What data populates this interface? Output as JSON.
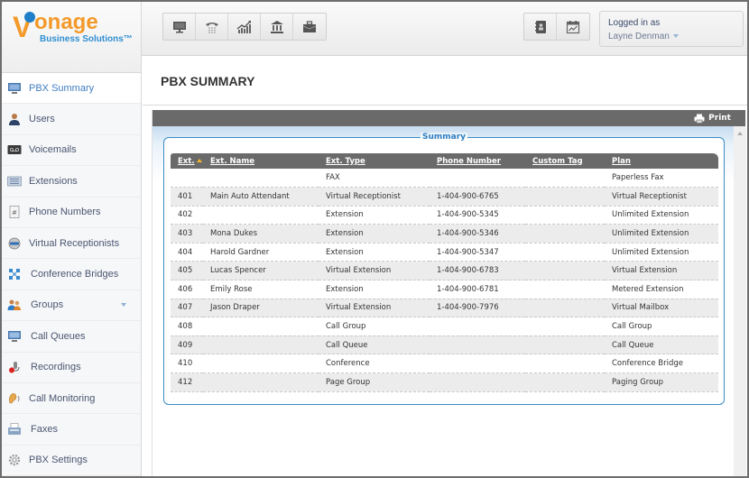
{
  "brand": {
    "logo_main": "onage",
    "logo_v": "V",
    "logo_sub": "Business Solutions™",
    "orange": "#f39a2a",
    "blue": "#1f7fc9"
  },
  "toolbar_left": [
    {
      "icon": "monitor-icon",
      "label": "Desktop"
    },
    {
      "icon": "phone-icon",
      "label": "Phone"
    },
    {
      "icon": "chart-growth-icon",
      "label": "Reports"
    },
    {
      "icon": "bank-icon",
      "label": "Billing"
    },
    {
      "icon": "briefcase-icon",
      "label": "Business"
    }
  ],
  "toolbar_right": [
    {
      "icon": "address-book-icon",
      "label": "Contacts"
    },
    {
      "icon": "calendar-chart-icon",
      "label": "Activity"
    }
  ],
  "user": {
    "logged_in_label": "Logged in as",
    "name": "Layne Denman"
  },
  "sidebar": {
    "items": [
      {
        "label": "PBX Summary",
        "icon": "monitor-icon",
        "active": true
      },
      {
        "label": "Users",
        "icon": "user-icon"
      },
      {
        "label": "Voicemails",
        "icon": "voicemail-icon"
      },
      {
        "label": "Extensions",
        "icon": "extensions-icon"
      },
      {
        "label": "Phone Numbers",
        "icon": "phone-number-icon"
      },
      {
        "label": "Virtual Receptionists",
        "icon": "receptionist-icon"
      },
      {
        "label": "Conference Bridges",
        "icon": "conference-icon"
      },
      {
        "label": "Groups",
        "icon": "group-icon",
        "expandable": true
      },
      {
        "label": "Call Queues",
        "icon": "call-queue-icon"
      },
      {
        "label": "Recordings",
        "icon": "recording-icon"
      },
      {
        "label": "Call Monitoring",
        "icon": "ear-icon"
      },
      {
        "label": "Faxes",
        "icon": "fax-icon"
      },
      {
        "label": "PBX Settings",
        "icon": "gear-icon"
      }
    ]
  },
  "main": {
    "title": "PBX SUMMARY",
    "print_label": "Print",
    "fieldset_legend": "Summary",
    "table": {
      "columns": [
        "Ext.",
        "Ext. Name",
        "Ext. Type",
        "Phone Number",
        "Custom Tag",
        "Plan"
      ],
      "sorted_column": "Ext.",
      "sort_direction": "ascending",
      "rows": [
        [
          "",
          "",
          "FAX",
          "",
          "",
          "Paperless Fax"
        ],
        [
          "401",
          "Main Auto Attendant",
          "Virtual Receptionist",
          "1-404-900-6765",
          "",
          "Virtual Receptionist"
        ],
        [
          "402",
          "",
          "Extension",
          "1-404-900-5345",
          "",
          "Unlimited Extension"
        ],
        [
          "403",
          "Mona Dukes",
          "Extension",
          "1-404-900-5346",
          "",
          "Unlimited Extension"
        ],
        [
          "404",
          "Harold Gardner",
          "Extension",
          "1-404-900-5347",
          "",
          "Unlimited Extension"
        ],
        [
          "405",
          "Lucas Spencer",
          "Virtual Extension",
          "1-404-900-6783",
          "",
          "Virtual Extension"
        ],
        [
          "406",
          "Emily Rose",
          "Extension",
          "1-404-900-6781",
          "",
          "Metered Extension"
        ],
        [
          "407",
          "Jason Draper",
          "Virtual Extension",
          "1-404-900-7976",
          "",
          "Virtual Mailbox"
        ],
        [
          "408",
          "",
          "Call Group",
          "",
          "",
          "Call Group"
        ],
        [
          "409",
          "",
          "Call Queue",
          "",
          "",
          "Call Queue"
        ],
        [
          "410",
          "",
          "Conference",
          "",
          "",
          "Conference Bridge"
        ],
        [
          "412",
          "",
          "Page Group",
          "",
          "",
          "Paging Group"
        ]
      ]
    }
  }
}
